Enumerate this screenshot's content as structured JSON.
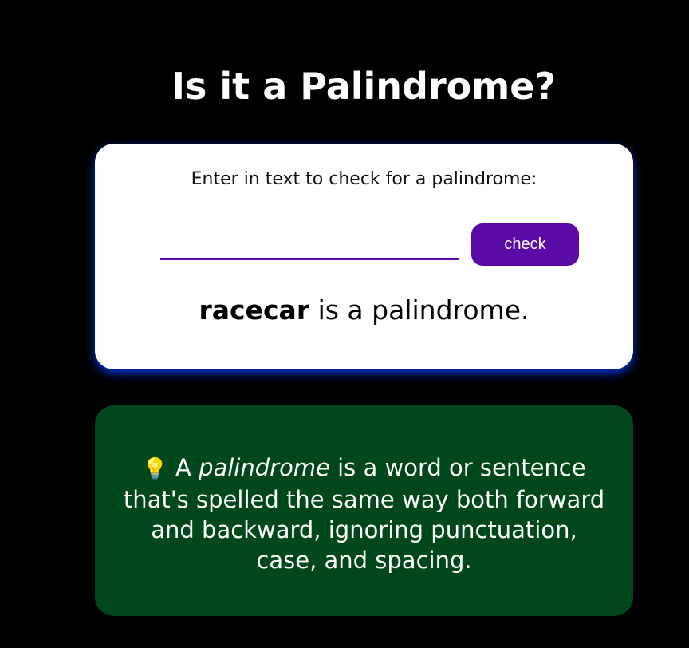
{
  "header": {
    "title": "Is it a Palindrome?"
  },
  "checker": {
    "prompt_label": "Enter in text to check for a palindrome:",
    "input_value": "",
    "button_label": "check",
    "result_word": "racecar",
    "result_suffix": " is a palindrome."
  },
  "info": {
    "icon": "lightbulb-icon",
    "lead": " A ",
    "term": "palindrome",
    "definition": " is a word or sentence that's spelled the same way both forward and backward, ignoring punctuation, case, and spacing."
  },
  "colors": {
    "background": "#000000",
    "accent": "#5b0aa8",
    "info_background": "#00471b",
    "card_glow": "#003aff"
  }
}
